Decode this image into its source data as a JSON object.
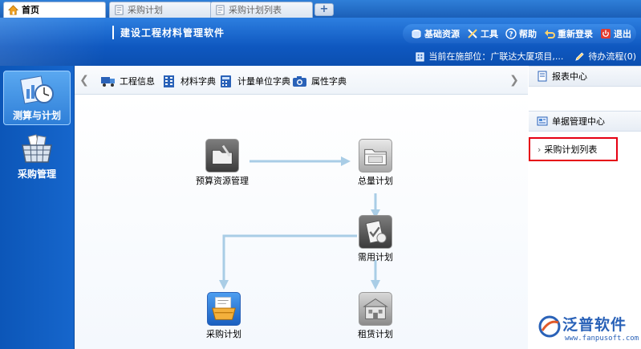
{
  "tabs": [
    {
      "label": "首页",
      "icon": "home-icon",
      "active": true
    },
    {
      "label": "采购计划",
      "icon": "document-icon",
      "active": false
    },
    {
      "label": "采购计划列表",
      "icon": "document-icon",
      "active": false
    }
  ],
  "tab_add_label": "+",
  "header": {
    "app_title": "建设工程材料管理软件",
    "toolbar": [
      {
        "label": "基础资源",
        "icon": "database-icon"
      },
      {
        "label": "工具",
        "icon": "tools-icon"
      },
      {
        "label": "帮助",
        "icon": "help-icon"
      },
      {
        "label": "重新登录",
        "icon": "relogin-icon"
      },
      {
        "label": "退出",
        "icon": "power-icon"
      }
    ],
    "current_dept_label": "当前在施部位：广联达大厦项目,...",
    "todo_label": "待办流程(0)"
  },
  "leftnav": [
    {
      "label": "测算与计划",
      "icon": "chart-clock-icon",
      "active": true
    },
    {
      "label": "采购管理",
      "icon": "shopping-basket-icon",
      "active": false
    }
  ],
  "subnav": [
    {
      "label": "工程信息",
      "icon": "truck-icon"
    },
    {
      "label": "材料字典",
      "icon": "building-icon"
    },
    {
      "label": "计量单位字典",
      "icon": "calculator-icon"
    },
    {
      "label": "属性字典",
      "icon": "camera-icon"
    }
  ],
  "flow": {
    "nodes": [
      {
        "label": "预算资源管理",
        "icon": "folder-budget-icon"
      },
      {
        "label": "总量计划",
        "icon": "folder-total-icon"
      },
      {
        "label": "需用计划",
        "icon": "clipboard-check-icon"
      },
      {
        "label": "采购计划",
        "icon": "basket-plan-icon"
      },
      {
        "label": "租赁计划",
        "icon": "lease-icon"
      }
    ]
  },
  "rightpanel": {
    "report_center": "报表中心",
    "doc_center": "单据管理中心",
    "link": "采购计划列表"
  },
  "watermark": {
    "brand": "泛普软件",
    "url": "www.fanpusoft.com"
  },
  "colors": {
    "header_blue": "#0f58c0",
    "highlight_red": "#e60012",
    "flow_arrow": "#a9cde6"
  }
}
